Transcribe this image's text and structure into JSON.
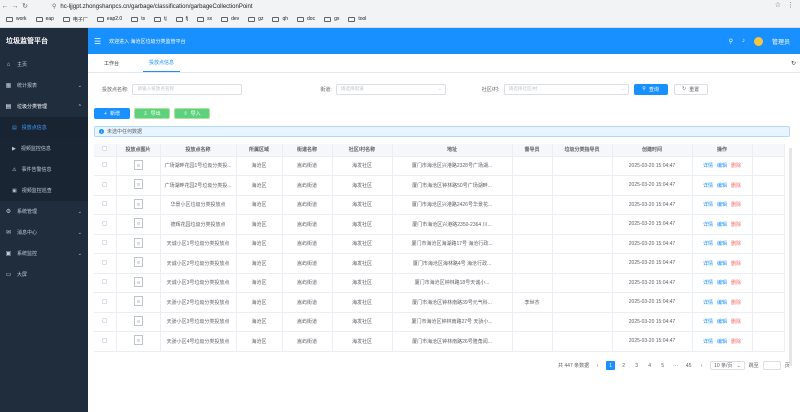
{
  "browser": {
    "url": "hc-ljjgpt.zhongshanpcs.cn/garbage/classification/garbageCollectionPoint",
    "bookmarks": [
      "work",
      "eap",
      "电子厂",
      "eap2.0",
      "ts",
      "tj",
      "fj",
      "sx",
      "dev",
      "gz",
      "qh",
      "doc",
      "gx",
      "tool"
    ]
  },
  "sidebar": {
    "title": "垃圾监管平台",
    "items": [
      {
        "label": "主页",
        "icon": "home-icon"
      },
      {
        "label": "统计报表",
        "icon": "chart-icon"
      },
      {
        "label": "垃圾分类管理",
        "icon": "trash-icon",
        "expanded": true,
        "children": [
          {
            "label": "投放点信息",
            "active": true
          },
          {
            "label": "视频监控信息"
          },
          {
            "label": "事件告警信息"
          },
          {
            "label": "视频监控巡查"
          }
        ]
      },
      {
        "label": "系统管理",
        "icon": "gear-icon"
      },
      {
        "label": "消息中心",
        "icon": "message-icon"
      },
      {
        "label": "系统监控",
        "icon": "monitor-icon"
      },
      {
        "label": "大屏",
        "icon": "screen-icon"
      }
    ]
  },
  "topbar": {
    "welcome": "欢迎进入 海沧区垃圾分类监管平台",
    "user": "管理员"
  },
  "tabs": [
    "工作台",
    "投放点信息"
  ],
  "filters": {
    "name_label": "投放点名称:",
    "name_placeholder": "请输入投放点名称",
    "street_label": "街道:",
    "street_placeholder": "请选择街道",
    "community_label": "社区/村:",
    "community_placeholder": "请选择社区/村",
    "search": "查询",
    "reset": "重置"
  },
  "actions": {
    "add": "新增",
    "export": "导出",
    "import": "导入"
  },
  "alert": "未选中任何数据",
  "table": {
    "headers": [
      "投放点图片",
      "投放点名称",
      "所属区域",
      "街道名称",
      "社区/村名称",
      "地址",
      "督导员",
      "垃圾分类指导员",
      "创建时间",
      "操作"
    ],
    "ops": [
      "详情",
      "编辑",
      "删除"
    ],
    "rows": [
      {
        "name": "广场湖畔花园1号垃圾分类投...",
        "district": "海沧区",
        "street": "嵩屿街道",
        "community": "海发社区",
        "address": "厦门市海沧区兴港路2328号广场湖...",
        "supervisor": "",
        "instructor": "",
        "time": "2025-03-20 15:04:47"
      },
      {
        "name": "广场湖畔花园2号垃圾分类投...",
        "district": "海沧区",
        "street": "嵩屿街道",
        "community": "海发社区",
        "address": "厦门市海沧区钟林路50号广场湖畔...",
        "supervisor": "",
        "instructor": "",
        "time": "2025-03-20 15:04:47"
      },
      {
        "name": "华景小区垃圾分类投放点",
        "district": "海沧区",
        "street": "嵩屿街道",
        "community": "海发社区",
        "address": "厦门市海沧区兴港路2426号华景花...",
        "supervisor": "",
        "instructor": "",
        "time": "2025-03-20 15:04:47"
      },
      {
        "name": "德辉花园垃圾分类投放点",
        "district": "海沧区",
        "street": "嵩屿街道",
        "community": "海发社区",
        "address": "厦门市海沧区兴港路2350-2364 川...",
        "supervisor": "",
        "instructor": "",
        "time": "2025-03-20 15:04:47"
      },
      {
        "name": "天诚小区1号垃圾分类投放点",
        "district": "海沧区",
        "street": "嵩屿街道",
        "community": "海发社区",
        "address": "厦门市海沧区海湖路17号 海沧行政...",
        "supervisor": "",
        "instructor": "",
        "time": "2025-03-20 15:04:47"
      },
      {
        "name": "天诚小区2号垃圾分类投放点",
        "district": "海沧区",
        "street": "嵩屿街道",
        "community": "海发社区",
        "address": "厦门市海沧区海林路4号 海沧行政...",
        "supervisor": "",
        "instructor": "",
        "time": "2025-03-20 15:04:47"
      },
      {
        "name": "天诚小区3号垃圾分类投放点",
        "district": "海沧区",
        "street": "嵩屿街道",
        "community": "海发社区",
        "address": "厦门市海沧区钟林路18号天诚小...",
        "supervisor": "",
        "instructor": "",
        "time": "2025-03-20 15:04:47"
      },
      {
        "name": "天骄小区2号垃圾分类投放点",
        "district": "海沧区",
        "street": "嵩屿街道",
        "community": "海发社区",
        "address": "厦门市海沧区钟林南路39号元气科...",
        "supervisor": "李世杰",
        "instructor": "",
        "time": "2025-03-20 15:04:47"
      },
      {
        "name": "天骄小区3号垃圾分类投放点",
        "district": "海沧区",
        "street": "嵩屿街道",
        "community": "海发社区",
        "address": "厦门市海沧区钟林南路27号 天骄小...",
        "supervisor": "",
        "instructor": "",
        "time": "2025-03-20 15:04:47"
      },
      {
        "name": "天骄小区4号垃圾分类投放点",
        "district": "海沧区",
        "street": "嵩屿街道",
        "community": "海发社区",
        "address": "厦门市海沧区钟林南路26号隆角闻...",
        "supervisor": "",
        "instructor": "",
        "time": "2025-03-20 15:04:47"
      }
    ]
  },
  "pager": {
    "total": "共 447 条数据",
    "pages": [
      "1",
      "2",
      "3",
      "4",
      "5",
      "···",
      "45"
    ],
    "size": "10 条/页",
    "goto": "跳至",
    "page_unit": "页"
  },
  "colors": {
    "primary": "#1890ff",
    "sidebar": "#1f2d3d",
    "danger": "#f56c6c",
    "success": "#5dd27e"
  }
}
